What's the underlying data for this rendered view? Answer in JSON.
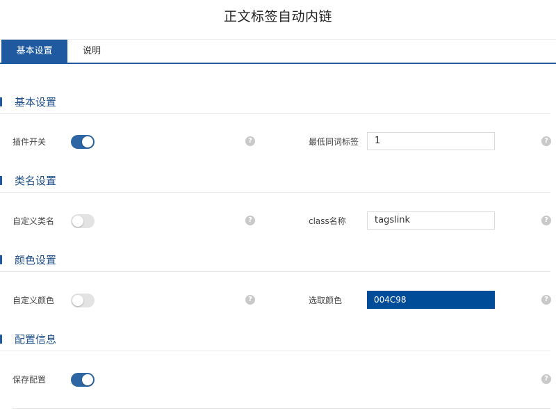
{
  "page": {
    "title": "正文标签自动内链"
  },
  "tabs": [
    {
      "label": "基本设置",
      "active": true
    },
    {
      "label": "说明",
      "active": false
    }
  ],
  "sections": [
    {
      "title": "基本设置",
      "left": {
        "label": "插件开关",
        "toggle_on": true
      },
      "right": {
        "label": "最低同词标签",
        "value": "1"
      }
    },
    {
      "title": "类名设置",
      "left": {
        "label": "自定义类名",
        "toggle_on": false
      },
      "right": {
        "label": "class名称",
        "value": "tagslink"
      }
    },
    {
      "title": "颜色设置",
      "left": {
        "label": "自定义颜色",
        "toggle_on": false
      },
      "right": {
        "label": "选取颜色",
        "value": "004C98",
        "color": "#004C98"
      }
    },
    {
      "title": "配置信息",
      "left": {
        "label": "保存配置",
        "toggle_on": true
      }
    }
  ],
  "help_glyph": "?",
  "colors": {
    "accent": "#1f5aa0",
    "toggle_on": "#2e66a4",
    "toggle_off": "#e3e3e3",
    "help": "#c9c9c9"
  }
}
